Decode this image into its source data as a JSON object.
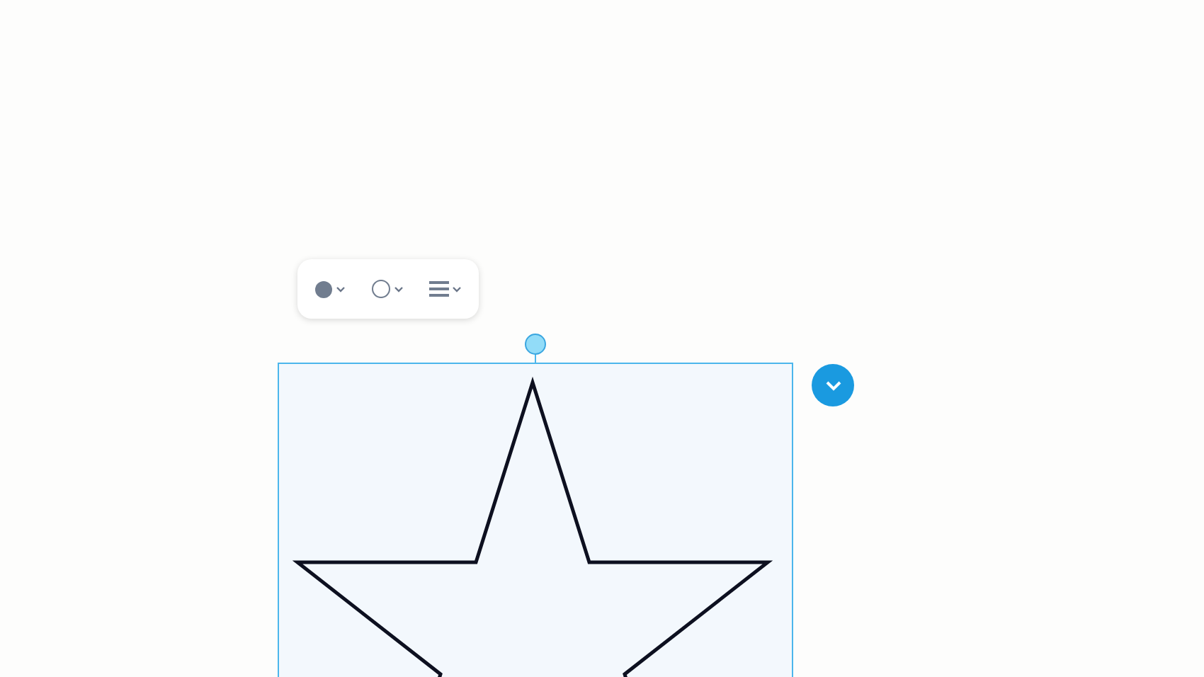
{
  "toolbar": {
    "buttons": [
      {
        "kind": "fill"
      },
      {
        "kind": "stroke"
      },
      {
        "kind": "line_style"
      }
    ]
  },
  "shape": {
    "kind": "star",
    "selected": true
  }
}
